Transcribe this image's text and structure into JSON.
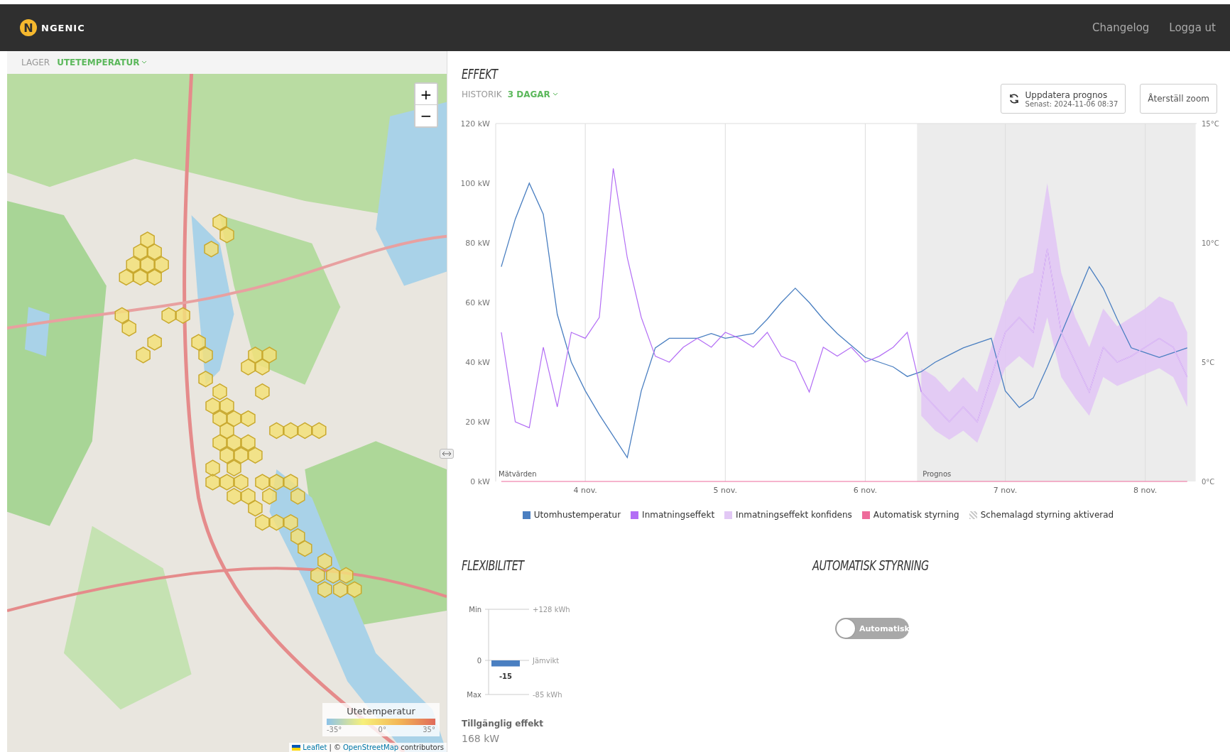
{
  "header": {
    "logo_letter": "N",
    "logo_text": "NGENIC",
    "links": [
      "Changelog",
      "Logga ut"
    ]
  },
  "map_panel": {
    "layer_label": "LAGER",
    "layer_value": "UTETEMPERATUR",
    "zoom_in": "+",
    "zoom_out": "−",
    "legend": {
      "title": "Utetemperatur",
      "min": "-35°",
      "mid": "0°",
      "max": "35°"
    },
    "attribution": {
      "leaflet": "Leaflet",
      "separator": "| ©",
      "osm": "OpenStreetMap",
      "rest": "contributors"
    }
  },
  "effekt": {
    "title": "EFFEKT",
    "history_label": "HISTORIK",
    "history_value": "3 DAGAR",
    "update_button": {
      "label": "Uppdatera prognos",
      "sub": "Senast: 2024-11-06 08:37"
    },
    "reset_button": "Återställ zoom",
    "chart_data": {
      "type": "line",
      "ylim": [
        0,
        120
      ],
      "y2lim": [
        0,
        15
      ],
      "categories": [
        null,
        null,
        null,
        null,
        null,
        null,
        "4 nov.",
        null,
        null,
        null,
        null,
        null,
        null,
        null,
        null,
        null,
        "5 nov.",
        null,
        null,
        null,
        null,
        null,
        null,
        null,
        null,
        null,
        "6 nov.",
        null,
        null,
        null,
        null,
        null,
        null,
        null,
        null,
        null,
        "7 nov.",
        null,
        null,
        null,
        null,
        null,
        null,
        null,
        null,
        null,
        "8 nov.",
        null,
        null,
        null
      ],
      "yticks": [
        {
          "value": 0,
          "label": "0 kW"
        },
        {
          "value": 20,
          "label": "20 kW"
        },
        {
          "value": 40,
          "label": "40 kW"
        },
        {
          "value": 60,
          "label": "60 kW"
        },
        {
          "value": 80,
          "label": "80 kW"
        },
        {
          "value": 100,
          "label": "100 kW"
        },
        {
          "value": 120,
          "label": "120 kW"
        }
      ],
      "y2ticks": [
        {
          "value": 0,
          "label": "0°C"
        },
        {
          "value": 5,
          "label": "5°C"
        },
        {
          "value": 10,
          "label": "10°C"
        },
        {
          "value": 15,
          "label": "15°C"
        }
      ],
      "series": [
        {
          "name": "Utomhustemperatur",
          "axis": "y2",
          "color": "#4a7fc1",
          "values": [
            9,
            11,
            12.5,
            11.2,
            7,
            5,
            3.8,
            2.8,
            1.9,
            1,
            3.8,
            5.6,
            6,
            6,
            6,
            6.2,
            6,
            6.1,
            6.2,
            6.8,
            7.5,
            8.1,
            7.5,
            6.8,
            6.2,
            5.7,
            5.2,
            5,
            4.8,
            4.4,
            4.6,
            5,
            5.3,
            5.6,
            5.8,
            6,
            3.8,
            3.1,
            3.5,
            4.8,
            6.2,
            7.6,
            9,
            8.1,
            6.8,
            5.6,
            5.4,
            5.2,
            5.4,
            5.6
          ]
        },
        {
          "name": "Inmatningseffekt",
          "color": "#b36ef5",
          "values": [
            50,
            20,
            18,
            45,
            25,
            50,
            48,
            55,
            105,
            75,
            55,
            42,
            40,
            45,
            48,
            45,
            50,
            48,
            45,
            50,
            42,
            40,
            30,
            45,
            42,
            45,
            40,
            42,
            45,
            50,
            30,
            25,
            20,
            25,
            20,
            35,
            50,
            55,
            50,
            78,
            50,
            40,
            30,
            45,
            40,
            42,
            45,
            48,
            45,
            35
          ]
        },
        {
          "name": "Inmatningseffekt konfidens",
          "color": "#e2c8f5",
          "values": [
            null,
            null,
            null,
            null,
            null,
            null,
            null,
            null,
            null,
            null,
            null,
            null,
            null,
            null,
            null,
            null,
            null,
            null,
            null,
            null,
            null,
            null,
            null,
            null,
            null,
            null,
            null,
            null,
            null,
            null,
            30,
            25,
            20,
            25,
            20,
            35,
            50,
            55,
            50,
            78,
            50,
            40,
            30,
            45,
            40,
            42,
            45,
            48,
            45,
            35
          ],
          "lower": [
            null,
            null,
            null,
            null,
            null,
            null,
            null,
            null,
            null,
            null,
            null,
            null,
            null,
            null,
            null,
            null,
            null,
            null,
            null,
            null,
            null,
            null,
            null,
            null,
            null,
            null,
            null,
            null,
            null,
            null,
            22,
            17,
            14,
            17,
            13,
            25,
            38,
            42,
            38,
            55,
            35,
            28,
            22,
            35,
            32,
            34,
            36,
            38,
            35,
            25
          ],
          "upper": [
            null,
            null,
            null,
            null,
            null,
            null,
            null,
            null,
            null,
            null,
            null,
            null,
            null,
            null,
            null,
            null,
            null,
            null,
            null,
            null,
            null,
            null,
            null,
            null,
            null,
            null,
            null,
            null,
            null,
            null,
            38,
            35,
            30,
            35,
            30,
            45,
            60,
            68,
            70,
            100,
            70,
            55,
            45,
            58,
            52,
            55,
            58,
            62,
            60,
            50
          ]
        },
        {
          "name": "Automatisk styrning",
          "color": "#ee6b9b",
          "values": [
            0,
            0,
            0,
            0,
            0,
            0,
            0,
            0,
            0,
            0,
            0,
            0,
            0,
            0,
            0,
            0,
            0,
            0,
            0,
            0,
            0,
            0,
            0,
            0,
            0,
            0,
            0,
            0,
            0,
            0,
            0,
            0,
            0,
            0,
            0,
            0,
            0,
            0,
            0,
            0,
            0,
            0,
            0,
            0,
            0,
            0,
            0,
            0,
            0,
            0
          ]
        }
      ],
      "grid": true,
      "annotations": [
        {
          "y": 0,
          "text": "Mätvärden"
        },
        {
          "y": 0,
          "text": "Prognos"
        }
      ]
    },
    "legend_extra": [
      {
        "label": "Schemalagd styrning aktiverad",
        "kind": "hatch"
      }
    ]
  },
  "flexibility": {
    "title": "FLEXIBILITET",
    "gauge": {
      "tick_labels": [
        "Min",
        "0",
        "Max"
      ],
      "side_labels": [
        "+128 kWh",
        "Jämvikt",
        "-85 kWh"
      ],
      "value_label": "-15"
    },
    "available_label": "Tillgänglig effekt",
    "available_value": "168 kW"
  },
  "automatic_control": {
    "title": "AUTOMATISK STYRNING",
    "switch": {
      "label": "Automatisk",
      "on": false
    }
  }
}
